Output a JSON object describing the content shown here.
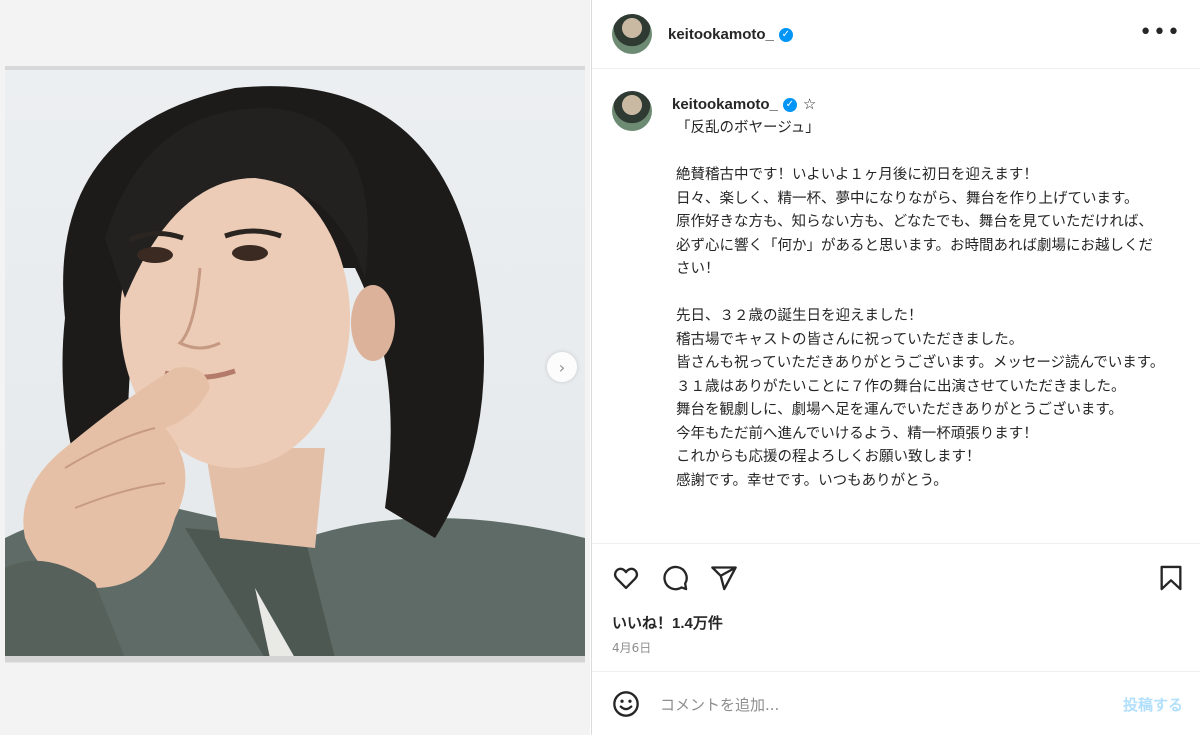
{
  "header": {
    "username": "keitookamoto_",
    "verified_icon": "verified-badge-icon",
    "more_icon": "more-options-icon",
    "more_label": "•••"
  },
  "media": {
    "next_icon": "chevron-right-icon",
    "next_label": "›"
  },
  "caption": {
    "username": "keitookamoto_",
    "star": "☆",
    "lines": [
      "「反乱のボヤージュ」",
      "",
      "絶賛稽古中です！いよいよ１ヶ月後に初日を迎えます！",
      "日々、楽しく、精一杯、夢中になりながら、舞台を作り上げています。",
      "原作好きな方も、知らない方も、どなたでも、舞台を見ていただければ、必ず心に響く「何か」があると思います。お時間あれば劇場にお越しください！",
      "",
      "先日、３２歳の誕生日を迎えました！",
      "稽古場でキャストの皆さんに祝っていただきました。",
      "皆さんも祝っていただきありがとうございます。メッセージ読んでいます。",
      "３１歳はありがたいことに７作の舞台に出演させていただきました。",
      "舞台を観劇しに、劇場へ足を運んでいただきありがとうございます。",
      "今年もただ前へ進んでいけるよう、精一杯頑張ります！",
      "これからも応援の程よろしくお願い致します！",
      "感謝です。幸せです。いつもありがとう。"
    ]
  },
  "actions": {
    "like_icon": "heart-icon",
    "comment_icon": "comment-icon",
    "share_icon": "share-icon",
    "save_icon": "bookmark-icon",
    "likes_text": "いいね！1.4万件",
    "date_text": "4月6日"
  },
  "comment": {
    "emoji_icon": "emoji-icon",
    "placeholder": "コメントを追加...",
    "post_label": "投稿する"
  },
  "colors": {
    "accent": "#0095f6",
    "post_disabled": "#b2dffc",
    "muted": "#8e8e8e"
  }
}
